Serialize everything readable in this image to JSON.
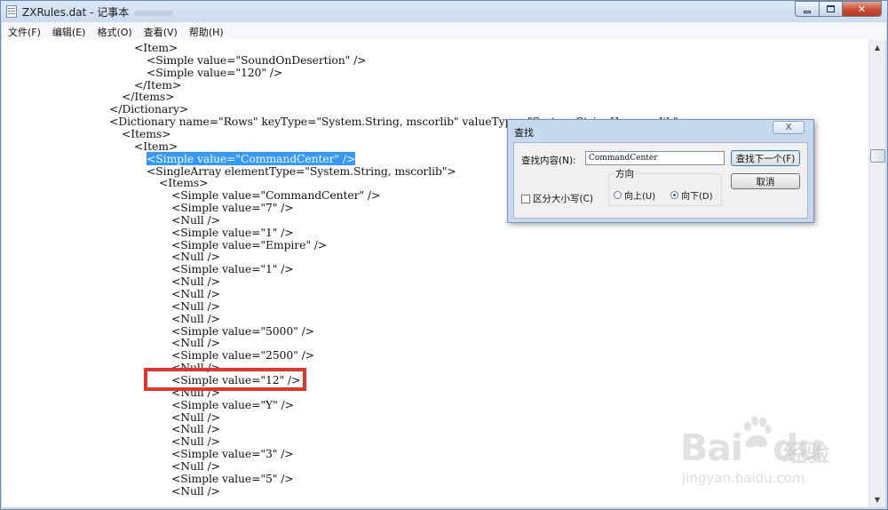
{
  "window": {
    "title": "ZXRules.dat - 记事本",
    "controls": {
      "minimize": "minimize",
      "maximize": "maximize",
      "close": "✕"
    }
  },
  "menu": [
    "文件(F)",
    "编辑(E)",
    "格式(O)",
    "查看(V)",
    "帮助(H)"
  ],
  "editor": {
    "lines": [
      {
        "indent": 4,
        "text": "<Item>"
      },
      {
        "indent": 5,
        "text": "<Simple value=\"SoundOnDesertion\" />"
      },
      {
        "indent": 5,
        "text": "<Simple value=\"120\" />"
      },
      {
        "indent": 4,
        "text": "</Item>"
      },
      {
        "indent": 3,
        "text": "</Items>"
      },
      {
        "indent": 2,
        "text": "</Dictionary>"
      },
      {
        "indent": 2,
        "text": "<Dictionary name=\"Rows\" keyType=\"System.String, mscorlib\" valueType=\"System.String[], mscorlib\">"
      },
      {
        "indent": 3,
        "text": "<Items>"
      },
      {
        "indent": 4,
        "text": "<Item>"
      },
      {
        "indent": 5,
        "text": "<Simple value=\"CommandCenter\" />",
        "selected": true
      },
      {
        "indent": 5,
        "text": "<SingleArray elementType=\"System.String, mscorlib\">"
      },
      {
        "indent": 6,
        "text": "<Items>"
      },
      {
        "indent": 7,
        "text": "<Simple value=\"CommandCenter\" />"
      },
      {
        "indent": 7,
        "text": "<Simple value=\"7\" />"
      },
      {
        "indent": 7,
        "text": "<Null />"
      },
      {
        "indent": 7,
        "text": "<Simple value=\"1\" />"
      },
      {
        "indent": 7,
        "text": "<Simple value=\"Empire\" />"
      },
      {
        "indent": 7,
        "text": "<Null />"
      },
      {
        "indent": 7,
        "text": "<Simple value=\"1\" />"
      },
      {
        "indent": 7,
        "text": "<Null />"
      },
      {
        "indent": 7,
        "text": "<Null />"
      },
      {
        "indent": 7,
        "text": "<Null />"
      },
      {
        "indent": 7,
        "text": "<Null />"
      },
      {
        "indent": 7,
        "text": "<Simple value=\"5000\" />"
      },
      {
        "indent": 7,
        "text": "<Null />"
      },
      {
        "indent": 7,
        "text": "<Simple value=\"2500\" />"
      },
      {
        "indent": 7,
        "text": "<Null />"
      },
      {
        "indent": 7,
        "text": "<Simple value=\"12\" />"
      },
      {
        "indent": 7,
        "text": "<Null />"
      },
      {
        "indent": 7,
        "text": "<Simple value=\"Y\" />"
      },
      {
        "indent": 7,
        "text": "<Null />"
      },
      {
        "indent": 7,
        "text": "<Null />"
      },
      {
        "indent": 7,
        "text": "<Null />"
      },
      {
        "indent": 7,
        "text": "<Simple value=\"3\" />"
      },
      {
        "indent": 7,
        "text": "<Null />"
      },
      {
        "indent": 7,
        "text": "<Simple value=\"5\" />"
      },
      {
        "indent": 7,
        "text": "<Null />"
      }
    ]
  },
  "find_dialog": {
    "title": "查找",
    "close": "X",
    "find_label": "查找内容(N):",
    "find_value": "CommandCenter",
    "find_next_button": "查找下一个(F)",
    "cancel_button": "取消",
    "direction_label": "方向",
    "direction_up": "向上(U)",
    "direction_down": "向下(D)",
    "direction_selected": "down",
    "match_case_label": "区分大小写(C)",
    "match_case_checked": false
  },
  "annotation": {
    "color": "#e8322c",
    "target_line_text": "<Simple value=\"12\" />"
  },
  "colors": {
    "selection": "#3399ff",
    "title_bar": "#c9dbee",
    "close_button": "#c74a30"
  },
  "watermark": {
    "brand": "Bai",
    "brand_suffix": "du",
    "brand_cn": "经验",
    "url": "jingyan.baidu.com"
  }
}
